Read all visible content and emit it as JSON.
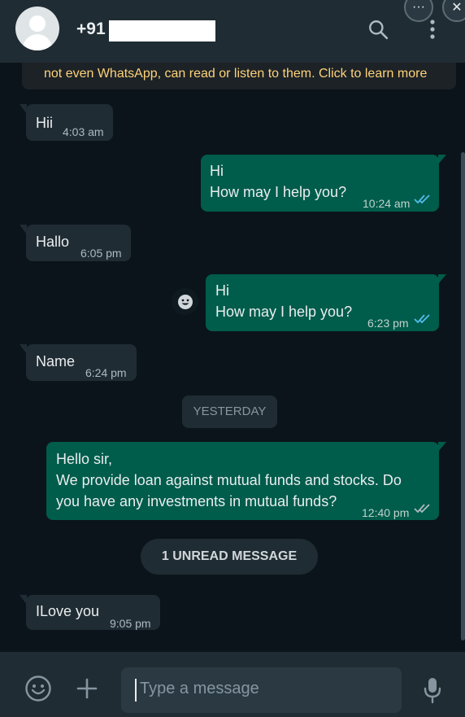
{
  "header": {
    "contact_name": "+91",
    "search_icon": "search-icon",
    "menu_icon": "vertical-dots-icon",
    "window_more": "···",
    "window_close": "✕"
  },
  "notice": {
    "text": "not even WhatsApp, can read or listen to them. Click to learn more",
    "color": "#ffd279"
  },
  "messages": [
    {
      "direction": "in",
      "text": "Hii",
      "time": "4:03 am"
    },
    {
      "direction": "out",
      "text": "Hi\nHow may I help you?",
      "time": "10:24 am",
      "status": "read"
    },
    {
      "direction": "in",
      "text": "Hallo",
      "time": "6:05 pm"
    },
    {
      "direction": "out",
      "text": "Hi\nHow may I help you?",
      "time": "6:23 pm",
      "status": "read"
    },
    {
      "direction": "in",
      "text": "Name",
      "time": "6:24 pm"
    },
    {
      "direction": "out",
      "text": "Hello sir,\nWe provide loan against mutual funds and stocks. Do\nyou have any investments in mutual funds?",
      "time": "12:40 pm",
      "status": "delivered"
    },
    {
      "direction": "in",
      "text": "ILove you",
      "time": "9:05 pm"
    }
  ],
  "day_separator": "YESTERDAY",
  "unread_label": "1 UNREAD MESSAGE",
  "composer": {
    "placeholder": "Type a message"
  },
  "colors": {
    "incoming_bubble": "#202c33",
    "outgoing_bubble": "#005c4b",
    "read_ticks": "#53bdeb",
    "app_bg": "#0b141a"
  }
}
